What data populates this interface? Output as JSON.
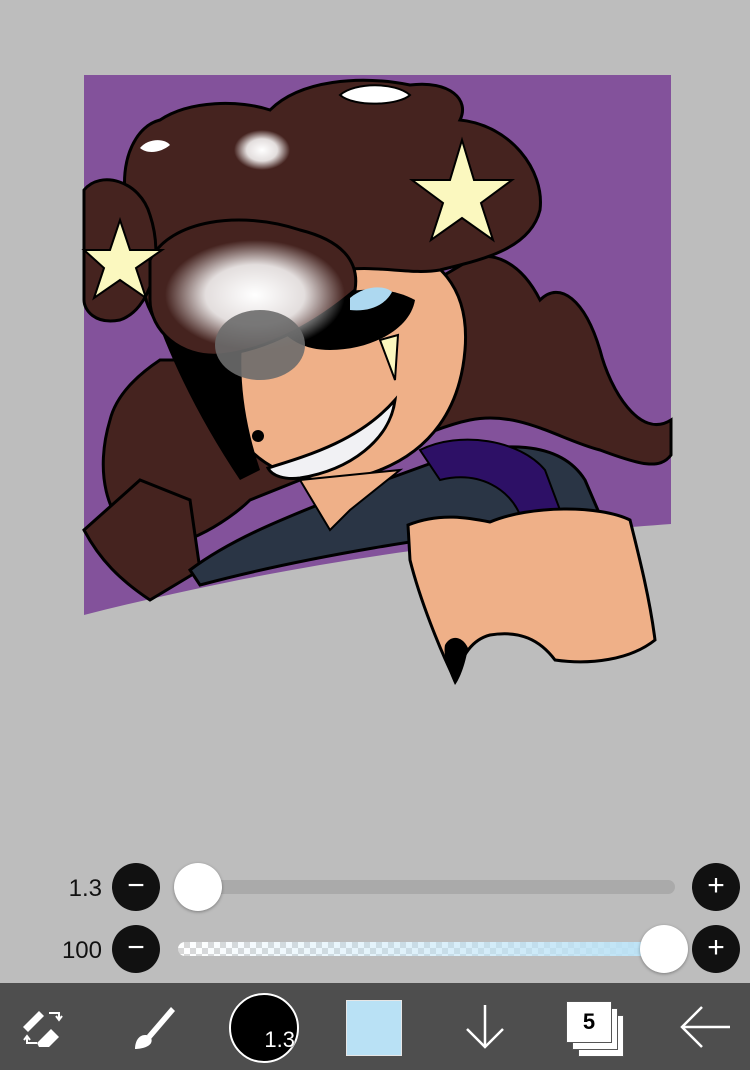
{
  "brush_size": {
    "value": "1.3",
    "minus_symbol": "−",
    "plus_symbol": "+",
    "level": 0.005
  },
  "opacity": {
    "value": "100",
    "minus_symbol": "−",
    "plus_symbol": "+",
    "level": 1.0
  },
  "toolbar": {
    "brush_size_label": "1.3",
    "current_color": "#b9e1f5",
    "layer_count": "5",
    "icons": [
      "tool-switch-icon",
      "brush-icon",
      "brush-size-icon",
      "color-swatch",
      "down-arrow-icon",
      "layers-icon",
      "back-arrow-icon"
    ]
  },
  "colors": {
    "background": "#bdbdbd",
    "canvas_purple": "#83529b",
    "hair_brown": "#45231f",
    "skin": "#efb088",
    "star_yellow": "#fbf8bf",
    "eye_blue": "#add8f0",
    "toolbar": "#4e4e4e"
  }
}
